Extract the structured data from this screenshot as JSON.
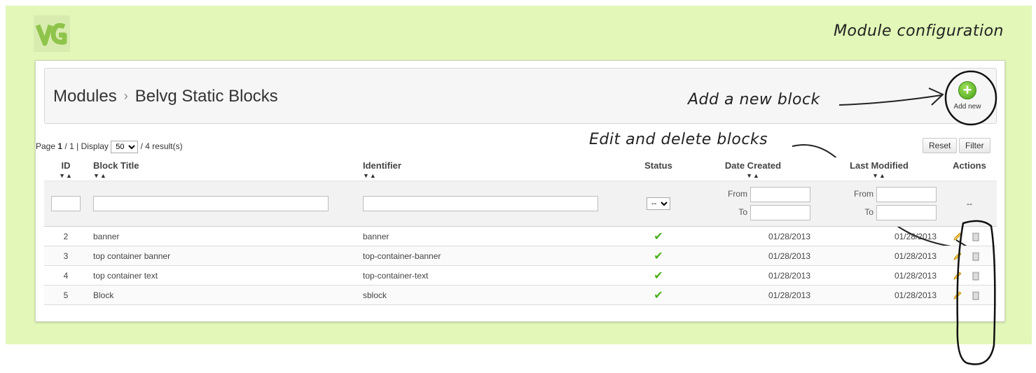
{
  "header": {
    "note": "Module configuration"
  },
  "toolbar": {
    "breadcrumb": [
      "Modules",
      "Belvg Static Blocks"
    ],
    "separator": "›",
    "add_note": "Add a new block",
    "add_new_label": "Add new"
  },
  "pager": {
    "page_label": "Page",
    "current": "1",
    "total": "1",
    "display_label": "Display",
    "per_page": "50",
    "results": "/ 4 result(s)"
  },
  "edit_note": "Edit and delete blocks",
  "buttons": {
    "reset": "Reset",
    "filter": "Filter"
  },
  "columns": [
    "ID",
    "Block Title",
    "Identifier",
    "Status",
    "Date Created",
    "Last Modified",
    "Actions"
  ],
  "filters": {
    "status_value": "--",
    "from_label": "From",
    "to_label": "To",
    "actions_value": "--"
  },
  "rows": [
    {
      "id": "2",
      "title": "banner",
      "identifier": "banner",
      "created": "01/28/2013",
      "modified": "01/28/2013"
    },
    {
      "id": "3",
      "title": "top container banner",
      "identifier": "top-container-banner",
      "created": "01/28/2013",
      "modified": "01/28/2013"
    },
    {
      "id": "4",
      "title": "top container text",
      "identifier": "top-container-text",
      "created": "01/28/2013",
      "modified": "01/28/2013"
    },
    {
      "id": "5",
      "title": "Block",
      "identifier": "sblock",
      "created": "01/28/2013",
      "modified": "01/28/2013"
    }
  ],
  "icons": {
    "status": "check-icon",
    "edit": "pencil-icon",
    "delete": "trash-icon",
    "add": "plus-circle-icon"
  },
  "colors": {
    "background": "#e2f7b8",
    "status_ok": "#4caf1e",
    "add_button": "#4aa21a"
  }
}
